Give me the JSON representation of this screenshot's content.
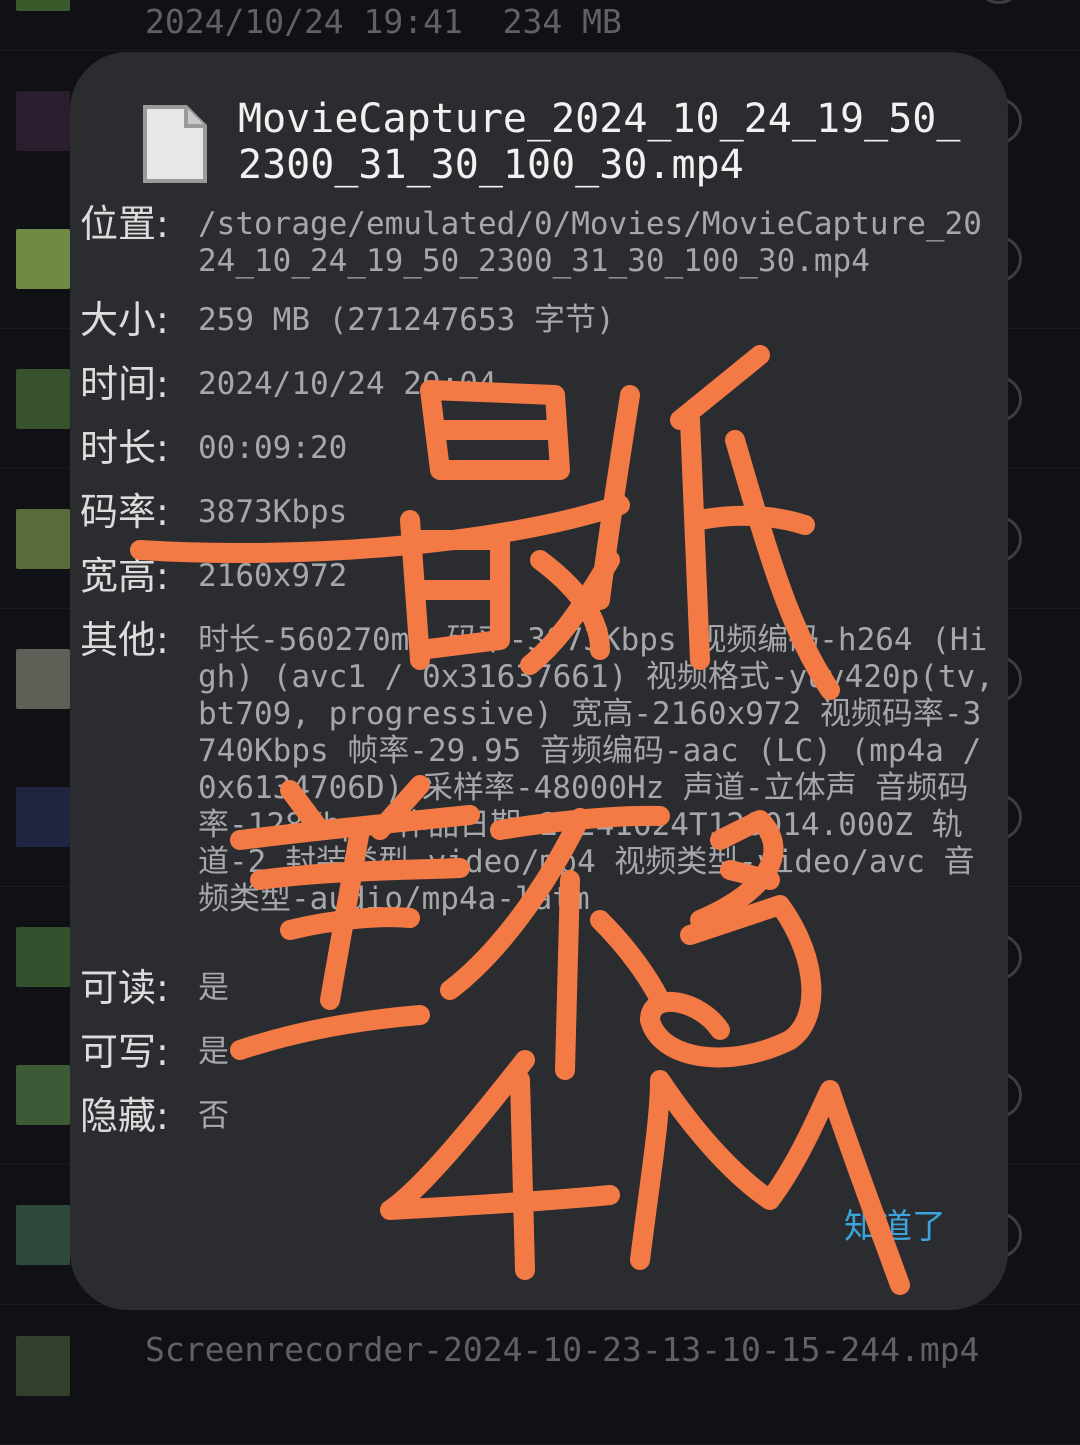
{
  "background_list": {
    "top_item": {
      "date": "2024/10/24 19:41",
      "size": "234 MB"
    },
    "bottom_item": {
      "name": "Screenrecorder-2024-10-23-13-10-15-244.mp4"
    }
  },
  "dialog": {
    "file_name": "MovieCapture_2024_10_24_19_50_2300_31_30_100_30.mp4",
    "properties": [
      {
        "label": "位置:",
        "value": "/storage/emulated/0/Movies/MovieCapture_2024_10_24_19_50_2300_31_30_100_30.mp4"
      },
      {
        "label": "大小:",
        "value": "259 MB (271247653 字节)"
      },
      {
        "label": "时间:",
        "value": "2024/10/24 20:04"
      },
      {
        "label": "时长:",
        "value": "00:09:20"
      },
      {
        "label": "码率:",
        "value": "3873Kbps"
      },
      {
        "label": "宽高:",
        "value": "2160x972"
      },
      {
        "label": "其他:",
        "value": "时长-560270ms 码率-3873Kbps 视频编码-h264 (High) (avc1 / 0x31637661) 视频格式-yuv420p(tv, bt709, progressive) 宽高-2160x972 视频码率-3740Kbps 帧率-29.95 音频编码-aac (LC) (mp4a / 0x6134706D) 采样率-48000Hz 声道-立体声 音频码率-128Kbps 作品日期-20241024T120014.000Z 轨道-2 封装类型-video/mp4 视频类型-video/avc 音频类型-audio/mp4a-latm"
      },
      {
        "label": "可读:",
        "value": "是"
      },
      {
        "label": "可写:",
        "value": "是"
      },
      {
        "label": "隐藏:",
        "value": "否"
      }
    ],
    "ok_label": "知道了"
  },
  "annotation": {
    "color": "#f47a45",
    "handwritten_text": "最低差不多4M"
  },
  "colors": {
    "dialog_bg": "#2b2c30",
    "label": "#dcdcdc",
    "value": "#a5a7ab",
    "accent": "#3aa4dc"
  }
}
